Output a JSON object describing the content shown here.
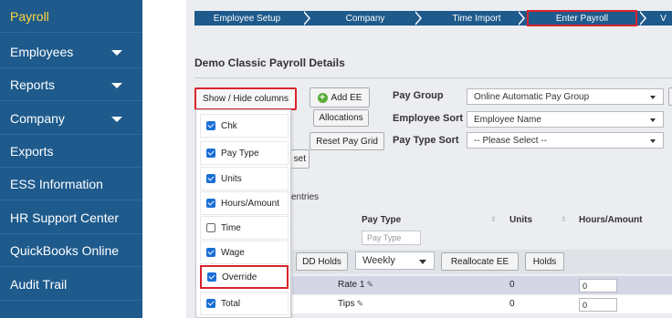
{
  "sidebar": {
    "items": [
      {
        "label": "Payroll",
        "active": true
      },
      {
        "label": "Employees",
        "caret": true
      },
      {
        "label": "Reports",
        "caret": true
      },
      {
        "label": "Company",
        "caret": true
      },
      {
        "label": "Exports"
      },
      {
        "label": "ESS Information"
      },
      {
        "label": "HR Support Center"
      },
      {
        "label": "QuickBooks Online"
      },
      {
        "label": "Audit Trail"
      }
    ]
  },
  "steps": [
    "Employee Setup",
    "Company",
    "Time Import",
    "Enter Payroll",
    "V"
  ],
  "section_title": "Demo Classic Payroll Details",
  "toolbar": {
    "show_hide": "Show / Hide columns",
    "add_ee": "Add EE",
    "allocations": "Allocations",
    "reset_pay_grid": "Reset Pay Grid",
    "set_partial": "set",
    "entries_partial": "entries"
  },
  "fields": {
    "pay_group_label": "Pay Group",
    "pay_group_value": "Online Automatic Pay Group",
    "employee_sort_label": "Employee Sort",
    "employee_sort_value": "Employee Name",
    "pay_type_sort_label": "Pay Type Sort",
    "pay_type_sort_value": "-- Please Select --"
  },
  "columns_menu": [
    {
      "label": "Chk",
      "checked": true
    },
    {
      "label": "Pay Type",
      "checked": true
    },
    {
      "label": "Units",
      "checked": true
    },
    {
      "label": "Hours/Amount",
      "checked": true
    },
    {
      "label": "Time",
      "checked": false
    },
    {
      "label": "Wage",
      "checked": true
    },
    {
      "label": "Override",
      "checked": true
    },
    {
      "label": "Total",
      "checked": true
    }
  ],
  "grid": {
    "headers": {
      "pay_type": "Pay Type",
      "units": "Units",
      "hours_amount": "Hours/Amount"
    },
    "filter_placeholder": "Pay Type",
    "dd_holds": "DD Holds",
    "frequency": "Weekly",
    "reallocate": "Reallocate EE",
    "holds": "Holds",
    "rows": [
      {
        "pay_type": "Rate 1",
        "units": "0",
        "hours": "0"
      },
      {
        "pay_type": "Tips",
        "units": "0",
        "hours": "0"
      }
    ]
  },
  "colors": {
    "sidebar": "#1e5a8c",
    "active": "#ffd83a",
    "highlight": "#d9232d",
    "checkbox": "#1a6fd6"
  }
}
